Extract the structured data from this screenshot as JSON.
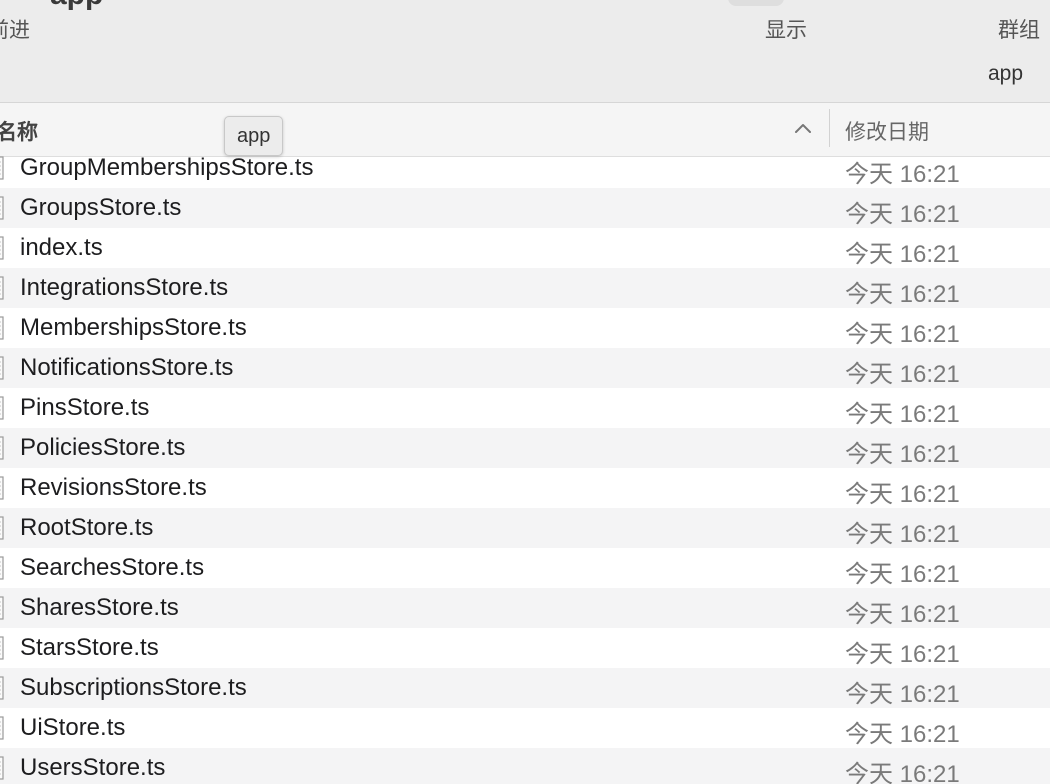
{
  "window": {
    "title": "app",
    "nav_label": "前进",
    "view_label": "显示",
    "group_label": "群组",
    "path_label": "app"
  },
  "columns": {
    "name": "名称",
    "date_modified": "修改日期"
  },
  "tooltip": "app",
  "files": [
    {
      "name": "GroupMembershipsStore.ts",
      "date": "今天 16:21"
    },
    {
      "name": "GroupsStore.ts",
      "date": "今天 16:21"
    },
    {
      "name": "index.ts",
      "date": "今天 16:21"
    },
    {
      "name": "IntegrationsStore.ts",
      "date": "今天 16:21"
    },
    {
      "name": "MembershipsStore.ts",
      "date": "今天 16:21"
    },
    {
      "name": "NotificationsStore.ts",
      "date": "今天 16:21"
    },
    {
      "name": "PinsStore.ts",
      "date": "今天 16:21"
    },
    {
      "name": "PoliciesStore.ts",
      "date": "今天 16:21"
    },
    {
      "name": "RevisionsStore.ts",
      "date": "今天 16:21"
    },
    {
      "name": "RootStore.ts",
      "date": "今天 16:21"
    },
    {
      "name": "SearchesStore.ts",
      "date": "今天 16:21"
    },
    {
      "name": "SharesStore.ts",
      "date": "今天 16:21"
    },
    {
      "name": "StarsStore.ts",
      "date": "今天 16:21"
    },
    {
      "name": "SubscriptionsStore.ts",
      "date": "今天 16:21"
    },
    {
      "name": "UiStore.ts",
      "date": "今天 16:21"
    },
    {
      "name": "UsersStore.ts",
      "date": "今天 16:21"
    }
  ]
}
